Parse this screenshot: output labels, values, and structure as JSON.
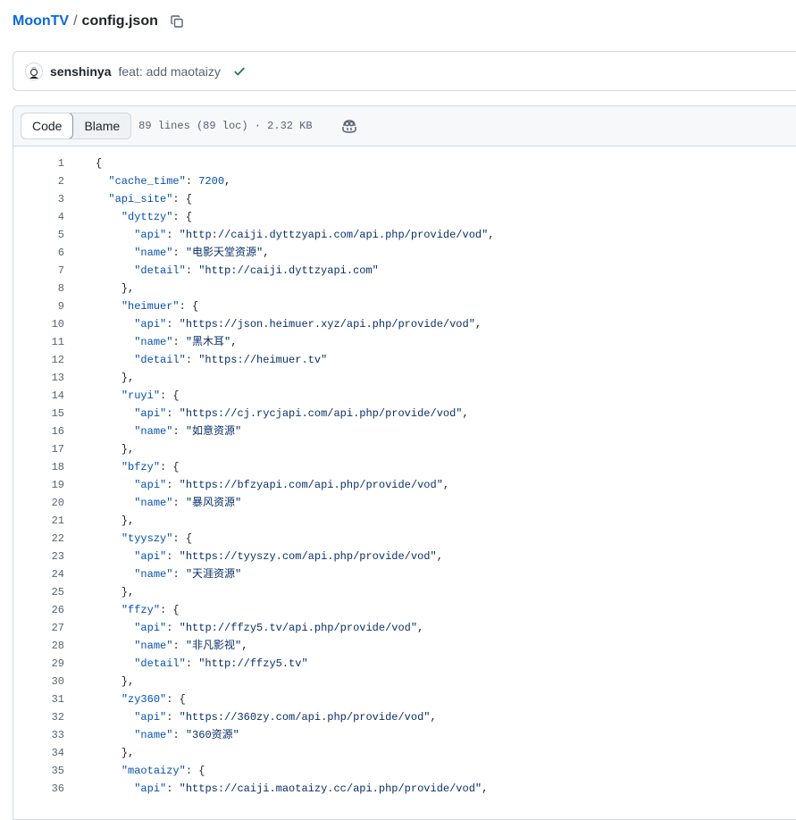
{
  "breadcrumb": {
    "repo": "MoonTV",
    "separator": "/",
    "file": "config.json"
  },
  "icons": {
    "copy": "copy-icon",
    "check": "check-icon",
    "copilot": "copilot-icon"
  },
  "commit": {
    "author": "senshinya",
    "message": "feat: add maotaizy",
    "status_color": "#1a7f37"
  },
  "file_header": {
    "tabs": [
      "Code",
      "Blame"
    ],
    "active_tab": "Code",
    "meta": "89 lines (89 loc) · 2.32 KB"
  },
  "colors": {
    "link": "#0969da",
    "key": "#0550ae",
    "string": "#0a3069"
  },
  "code_lines": [
    {
      "n": "1",
      "parts": [
        [
          "p",
          "{"
        ]
      ]
    },
    {
      "n": "2",
      "parts": [
        [
          "p",
          "  "
        ],
        [
          "k",
          "\"cache_time\""
        ],
        [
          "p",
          ": "
        ],
        [
          "n",
          "7200"
        ],
        [
          "p",
          ","
        ]
      ]
    },
    {
      "n": "3",
      "parts": [
        [
          "p",
          "  "
        ],
        [
          "k",
          "\"api_site\""
        ],
        [
          "p",
          ": {"
        ]
      ]
    },
    {
      "n": "4",
      "parts": [
        [
          "p",
          "    "
        ],
        [
          "k",
          "\"dyttzy\""
        ],
        [
          "p",
          ": {"
        ]
      ]
    },
    {
      "n": "5",
      "parts": [
        [
          "p",
          "      "
        ],
        [
          "k",
          "\"api\""
        ],
        [
          "p",
          ": "
        ],
        [
          "s",
          "\"http://caiji.dyttzyapi.com/api.php/provide/vod\""
        ],
        [
          "p",
          ","
        ]
      ]
    },
    {
      "n": "6",
      "parts": [
        [
          "p",
          "      "
        ],
        [
          "k",
          "\"name\""
        ],
        [
          "p",
          ": "
        ],
        [
          "s",
          "\"电影天堂资源\""
        ],
        [
          "p",
          ","
        ]
      ]
    },
    {
      "n": "7",
      "parts": [
        [
          "p",
          "      "
        ],
        [
          "k",
          "\"detail\""
        ],
        [
          "p",
          ": "
        ],
        [
          "s",
          "\"http://caiji.dyttzyapi.com\""
        ]
      ]
    },
    {
      "n": "8",
      "parts": [
        [
          "p",
          "    },"
        ]
      ]
    },
    {
      "n": "9",
      "parts": [
        [
          "p",
          "    "
        ],
        [
          "k",
          "\"heimuer\""
        ],
        [
          "p",
          ": {"
        ]
      ]
    },
    {
      "n": "10",
      "parts": [
        [
          "p",
          "      "
        ],
        [
          "k",
          "\"api\""
        ],
        [
          "p",
          ": "
        ],
        [
          "s",
          "\"https://json.heimuer.xyz/api.php/provide/vod\""
        ],
        [
          "p",
          ","
        ]
      ]
    },
    {
      "n": "11",
      "parts": [
        [
          "p",
          "      "
        ],
        [
          "k",
          "\"name\""
        ],
        [
          "p",
          ": "
        ],
        [
          "s",
          "\"黑木耳\""
        ],
        [
          "p",
          ","
        ]
      ]
    },
    {
      "n": "12",
      "parts": [
        [
          "p",
          "      "
        ],
        [
          "k",
          "\"detail\""
        ],
        [
          "p",
          ": "
        ],
        [
          "s",
          "\"https://heimuer.tv\""
        ]
      ]
    },
    {
      "n": "13",
      "parts": [
        [
          "p",
          "    },"
        ]
      ]
    },
    {
      "n": "14",
      "parts": [
        [
          "p",
          "    "
        ],
        [
          "k",
          "\"ruyi\""
        ],
        [
          "p",
          ": {"
        ]
      ]
    },
    {
      "n": "15",
      "parts": [
        [
          "p",
          "      "
        ],
        [
          "k",
          "\"api\""
        ],
        [
          "p",
          ": "
        ],
        [
          "s",
          "\"https://cj.rycjapi.com/api.php/provide/vod\""
        ],
        [
          "p",
          ","
        ]
      ]
    },
    {
      "n": "16",
      "parts": [
        [
          "p",
          "      "
        ],
        [
          "k",
          "\"name\""
        ],
        [
          "p",
          ": "
        ],
        [
          "s",
          "\"如意资源\""
        ]
      ]
    },
    {
      "n": "17",
      "parts": [
        [
          "p",
          "    },"
        ]
      ]
    },
    {
      "n": "18",
      "parts": [
        [
          "p",
          "    "
        ],
        [
          "k",
          "\"bfzy\""
        ],
        [
          "p",
          ": {"
        ]
      ]
    },
    {
      "n": "19",
      "parts": [
        [
          "p",
          "      "
        ],
        [
          "k",
          "\"api\""
        ],
        [
          "p",
          ": "
        ],
        [
          "s",
          "\"https://bfzyapi.com/api.php/provide/vod\""
        ],
        [
          "p",
          ","
        ]
      ]
    },
    {
      "n": "20",
      "parts": [
        [
          "p",
          "      "
        ],
        [
          "k",
          "\"name\""
        ],
        [
          "p",
          ": "
        ],
        [
          "s",
          "\"暴风资源\""
        ]
      ]
    },
    {
      "n": "21",
      "parts": [
        [
          "p",
          "    },"
        ]
      ]
    },
    {
      "n": "22",
      "parts": [
        [
          "p",
          "    "
        ],
        [
          "k",
          "\"tyyszy\""
        ],
        [
          "p",
          ": {"
        ]
      ]
    },
    {
      "n": "23",
      "parts": [
        [
          "p",
          "      "
        ],
        [
          "k",
          "\"api\""
        ],
        [
          "p",
          ": "
        ],
        [
          "s",
          "\"https://tyyszy.com/api.php/provide/vod\""
        ],
        [
          "p",
          ","
        ]
      ]
    },
    {
      "n": "24",
      "parts": [
        [
          "p",
          "      "
        ],
        [
          "k",
          "\"name\""
        ],
        [
          "p",
          ": "
        ],
        [
          "s",
          "\"天涯资源\""
        ]
      ]
    },
    {
      "n": "25",
      "parts": [
        [
          "p",
          "    },"
        ]
      ]
    },
    {
      "n": "26",
      "parts": [
        [
          "p",
          "    "
        ],
        [
          "k",
          "\"ffzy\""
        ],
        [
          "p",
          ": {"
        ]
      ]
    },
    {
      "n": "27",
      "parts": [
        [
          "p",
          "      "
        ],
        [
          "k",
          "\"api\""
        ],
        [
          "p",
          ": "
        ],
        [
          "s",
          "\"http://ffzy5.tv/api.php/provide/vod\""
        ],
        [
          "p",
          ","
        ]
      ]
    },
    {
      "n": "28",
      "parts": [
        [
          "p",
          "      "
        ],
        [
          "k",
          "\"name\""
        ],
        [
          "p",
          ": "
        ],
        [
          "s",
          "\"非凡影视\""
        ],
        [
          "p",
          ","
        ]
      ]
    },
    {
      "n": "29",
      "parts": [
        [
          "p",
          "      "
        ],
        [
          "k",
          "\"detail\""
        ],
        [
          "p",
          ": "
        ],
        [
          "s",
          "\"http://ffzy5.tv\""
        ]
      ]
    },
    {
      "n": "30",
      "parts": [
        [
          "p",
          "    },"
        ]
      ]
    },
    {
      "n": "31",
      "parts": [
        [
          "p",
          "    "
        ],
        [
          "k",
          "\"zy360\""
        ],
        [
          "p",
          ": {"
        ]
      ]
    },
    {
      "n": "32",
      "parts": [
        [
          "p",
          "      "
        ],
        [
          "k",
          "\"api\""
        ],
        [
          "p",
          ": "
        ],
        [
          "s",
          "\"https://360zy.com/api.php/provide/vod\""
        ],
        [
          "p",
          ","
        ]
      ]
    },
    {
      "n": "33",
      "parts": [
        [
          "p",
          "      "
        ],
        [
          "k",
          "\"name\""
        ],
        [
          "p",
          ": "
        ],
        [
          "s",
          "\"360资源\""
        ]
      ]
    },
    {
      "n": "34",
      "parts": [
        [
          "p",
          "    },"
        ]
      ]
    },
    {
      "n": "35",
      "parts": [
        [
          "p",
          "    "
        ],
        [
          "k",
          "\"maotaizy\""
        ],
        [
          "p",
          ": {"
        ]
      ]
    },
    {
      "n": "36",
      "parts": [
        [
          "p",
          "      "
        ],
        [
          "k",
          "\"api\""
        ],
        [
          "p",
          ": "
        ],
        [
          "s",
          "\"https://caiji.maotaizy.cc/api.php/provide/vod\""
        ],
        [
          "p",
          ","
        ]
      ]
    }
  ]
}
